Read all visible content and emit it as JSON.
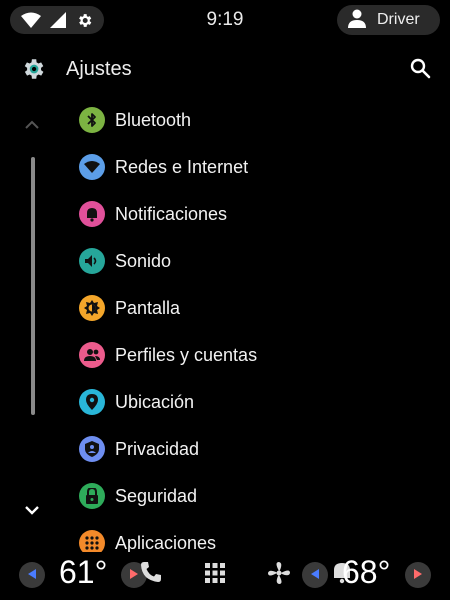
{
  "status_bar": {
    "time": "9:19",
    "icons": [
      "wifi-icon",
      "signal-icon",
      "settings-gear-icon"
    ],
    "user_label": "Driver"
  },
  "app_bar": {
    "title": "Ajustes",
    "icon": "settings-gear-icon",
    "search_icon": "search-icon"
  },
  "settings_items": [
    {
      "label": "Bluetooth",
      "icon": "bluetooth-icon",
      "color": "#7cb342"
    },
    {
      "label": "Redes e Internet",
      "icon": "wifi-icon",
      "color": "#5c9ee8"
    },
    {
      "label": "Notificaciones",
      "icon": "bell-icon",
      "color": "#e0509a"
    },
    {
      "label": "Sonido",
      "icon": "volume-icon",
      "color": "#26a69a"
    },
    {
      "label": "Pantalla",
      "icon": "brightness-icon",
      "color": "#f4a62a"
    },
    {
      "label": "Perfiles y cuentas",
      "icon": "people-icon",
      "color": "#ec5b8c"
    },
    {
      "label": "Ubicación",
      "icon": "location-pin-icon",
      "color": "#29b6d8"
    },
    {
      "label": "Privacidad",
      "icon": "privacy-shield-icon",
      "color": "#6e8ef0"
    },
    {
      "label": "Seguridad",
      "icon": "lock-icon",
      "color": "#2eab5a"
    },
    {
      "label": "Aplicaciones",
      "icon": "apps-grid-icon",
      "color": "#f38a2a"
    }
  ],
  "bottom_bar": {
    "left_temp": "61°",
    "right_temp": "68°",
    "icons": [
      "phone-icon",
      "app-grid-icon",
      "fan-icon",
      "bell-icon"
    ],
    "arrow_color": "#4a7cff",
    "arrow_right_color": "#ff6b6b"
  }
}
